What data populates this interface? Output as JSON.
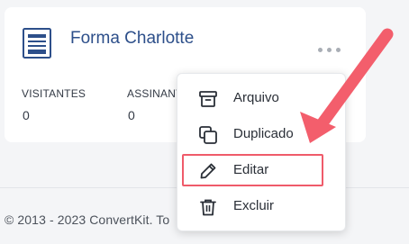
{
  "card": {
    "title": "Forma Charlotte",
    "icon": "form-icon",
    "stats": [
      {
        "label": "VISITANTES",
        "value": "0"
      },
      {
        "label": "ASSINANTES",
        "value": "0"
      }
    ]
  },
  "menu": {
    "items": [
      {
        "label": "Arquivo",
        "icon": "archive-icon"
      },
      {
        "label": "Duplicado",
        "icon": "duplicate-icon"
      },
      {
        "label": "Editar",
        "icon": "pencil-icon"
      },
      {
        "label": "Excluir",
        "icon": "trash-icon"
      }
    ],
    "highlighted_item": "Editar"
  },
  "footer": {
    "text": "© 2013 - 2023 ConvertKit. To"
  },
  "colors": {
    "title": "#2d4f8a",
    "highlight": "#ef5b6a",
    "arrow": "#f35e6c"
  }
}
